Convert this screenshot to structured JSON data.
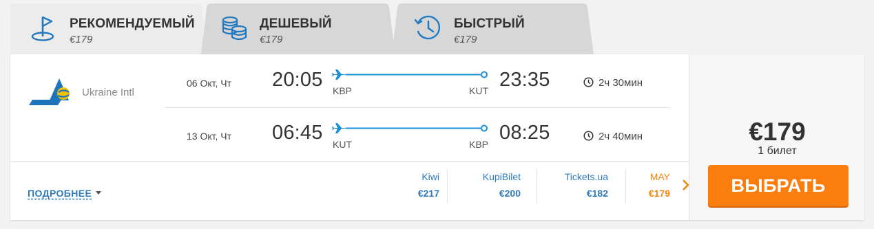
{
  "tabs": [
    {
      "title": "РЕКОМЕНДУЕМЫЙ",
      "price": "€179",
      "icon": "flag-icon"
    },
    {
      "title": "ДЕШЕВЫЙ",
      "price": "€179",
      "icon": "coins-icon"
    },
    {
      "title": "БЫСТРЫЙ",
      "price": "€179",
      "icon": "clock-history-icon"
    }
  ],
  "airline": {
    "name": "Ukraine Intl",
    "logo": "ukraine-intl-logo"
  },
  "flights": [
    {
      "date": "06 Окт, Чт",
      "dep_time": "20:05",
      "from": "KBP",
      "to": "KUT",
      "arr_time": "23:35",
      "duration": "2ч 30мин"
    },
    {
      "date": "13 Окт, Чт",
      "dep_time": "06:45",
      "from": "KUT",
      "to": "KBP",
      "arr_time": "08:25",
      "duration": "2ч 40мин"
    }
  ],
  "details_label": "ПОДРОБНЕЕ",
  "agencies": [
    {
      "name": "Kiwi",
      "price": "€217"
    },
    {
      "name": "KupiBilet",
      "price": "€200"
    },
    {
      "name": "Tickets.ua",
      "price": "€182"
    },
    {
      "name": "MAY",
      "price": "€179"
    }
  ],
  "offer": {
    "price": "€179",
    "tickets": "1 билет",
    "button": "ВЫБРАТЬ"
  },
  "colors": {
    "accent_blue": "#2f7ab8",
    "orange": "#fb7d0e",
    "route_blue": "#1a8fd8"
  }
}
